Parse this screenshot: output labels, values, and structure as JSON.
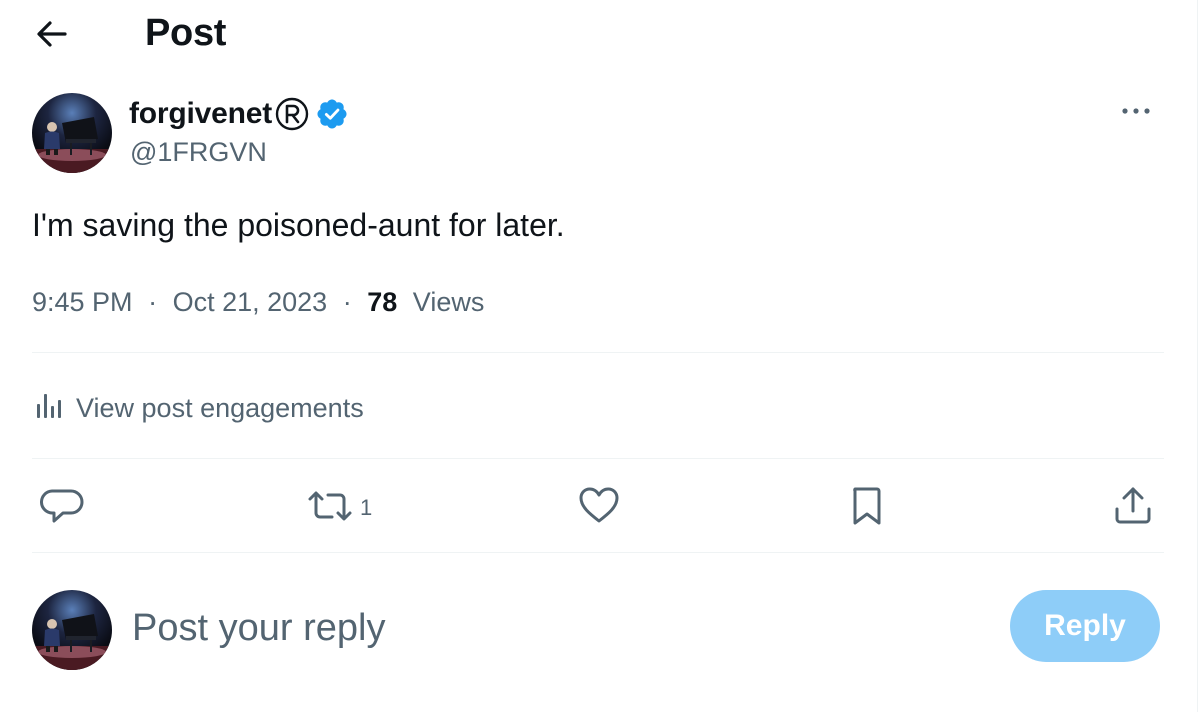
{
  "header": {
    "title": "Post",
    "back_icon": "arrow-left-icon"
  },
  "author": {
    "display_name": "forgivenet",
    "registered_mark": "®",
    "handle": "@1FRGVN",
    "verified": true,
    "verified_color": "#1d9bf0"
  },
  "post": {
    "text": "I'm saving the poisoned-aunt for later.",
    "time": "9:45 PM",
    "separator": "·",
    "date": "Oct 21, 2023",
    "views_count": "78",
    "views_label": "Views"
  },
  "engagements": {
    "label": "View post engagements",
    "icon": "bar-chart-icon"
  },
  "actions": {
    "reply": {
      "icon": "reply-bubble-icon",
      "count": ""
    },
    "repost": {
      "icon": "repost-icon",
      "count": "1"
    },
    "like": {
      "icon": "heart-icon",
      "count": ""
    },
    "bookmark": {
      "icon": "bookmark-icon",
      "count": ""
    },
    "share": {
      "icon": "share-icon",
      "count": ""
    }
  },
  "reply_composer": {
    "placeholder": "Post your reply",
    "button_label": "Reply",
    "button_color": "#8ecdf8"
  },
  "colors": {
    "primary_text": "#0f1419",
    "secondary_text": "#536471",
    "divider": "#eff3f4",
    "accent": "#1d9bf0"
  }
}
